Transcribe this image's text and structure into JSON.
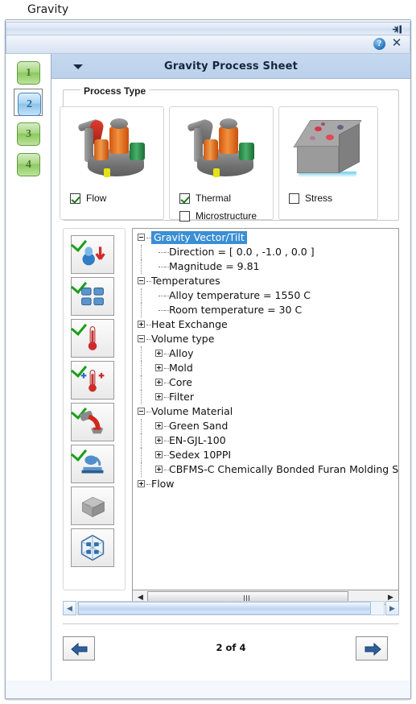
{
  "window": {
    "title": "Gravity",
    "toolbar": {
      "pin_icon": "collapse-pin-icon",
      "help_icon": "?",
      "close_icon": "✕"
    }
  },
  "steps": [
    {
      "label": "1",
      "selected": false
    },
    {
      "label": "2",
      "selected": true
    },
    {
      "label": "3",
      "selected": false
    },
    {
      "label": "4",
      "selected": false
    }
  ],
  "header": {
    "title": "Gravity Process Sheet",
    "caret_icon": "chevron-down-icon"
  },
  "process_type": {
    "group_label": "Process Type",
    "cards": [
      {
        "image": "casting-flow-illustration",
        "options": [
          {
            "label": "Flow",
            "checked": true
          }
        ]
      },
      {
        "image": "casting-thermal-illustration",
        "options": [
          {
            "label": "Thermal",
            "checked": true
          },
          {
            "label": "Microstructure",
            "checked": false
          }
        ]
      },
      {
        "image": "stress-block-illustration",
        "options": [
          {
            "label": "Stress",
            "checked": false
          }
        ]
      }
    ]
  },
  "tool_buttons": [
    {
      "name": "gravity-vector-icon",
      "checked": true
    },
    {
      "name": "volume-type-icon",
      "checked": true
    },
    {
      "name": "temperature-icon",
      "checked": true
    },
    {
      "name": "heat-exchange-icon",
      "checked": true
    },
    {
      "name": "pouring-icon",
      "checked": true
    },
    {
      "name": "filling-icon",
      "checked": true
    },
    {
      "name": "mold-block-icon",
      "checked": false
    },
    {
      "name": "mesh-cube-icon",
      "checked": false
    }
  ],
  "tree": {
    "nodes": [
      {
        "label": "Gravity Vector/Tilt",
        "depth": 0,
        "expander": "minus",
        "selected": true
      },
      {
        "label": "Direction = [ 0.0 , -1.0 , 0.0 ]",
        "depth": 1,
        "expander": "none",
        "selected": false
      },
      {
        "label": "Magnitude = 9.81",
        "depth": 1,
        "expander": "none",
        "selected": false
      },
      {
        "label": "Temperatures",
        "depth": 0,
        "expander": "minus",
        "selected": false
      },
      {
        "label": "Alloy temperature = 1550 C",
        "depth": 1,
        "expander": "none",
        "selected": false
      },
      {
        "label": "Room temperature = 30 C",
        "depth": 1,
        "expander": "none",
        "selected": false
      },
      {
        "label": "Heat Exchange",
        "depth": 0,
        "expander": "plus",
        "selected": false
      },
      {
        "label": "Volume type",
        "depth": 0,
        "expander": "minus",
        "selected": false
      },
      {
        "label": "Alloy",
        "depth": 1,
        "expander": "plus",
        "selected": false
      },
      {
        "label": "Mold",
        "depth": 1,
        "expander": "plus",
        "selected": false
      },
      {
        "label": "Core",
        "depth": 1,
        "expander": "plus",
        "selected": false
      },
      {
        "label": "Filter",
        "depth": 1,
        "expander": "plus",
        "selected": false
      },
      {
        "label": "Volume Material",
        "depth": 0,
        "expander": "minus",
        "selected": false
      },
      {
        "label": "Green Sand",
        "depth": 1,
        "expander": "plus",
        "selected": false
      },
      {
        "label": "EN-GJL-100",
        "depth": 1,
        "expander": "plus",
        "selected": false
      },
      {
        "label": "Sedex 10PPI",
        "depth": 1,
        "expander": "plus",
        "selected": false
      },
      {
        "label": "CBFMS-C Chemically Bonded Furan Molding Sand-C",
        "depth": 1,
        "expander": "plus",
        "selected": false
      },
      {
        "label": "Flow",
        "depth": 0,
        "expander": "plus",
        "selected": false
      }
    ]
  },
  "scrollbars": {
    "tree_left_arrow": "◀",
    "tree_right_arrow": "▶",
    "panel_left_arrow": "◀",
    "panel_right_arrow": "▶"
  },
  "footer": {
    "prev_label": "back-arrow-icon",
    "next_label": "forward-arrow-icon",
    "page_indicator": "2 of 4"
  },
  "colors": {
    "selection_blue": "#3a8fd4",
    "header_blue": "#c5d8ef",
    "check_green": "#17a017",
    "step_green": "#8cc95f",
    "step_blue": "#8cc3ea"
  }
}
